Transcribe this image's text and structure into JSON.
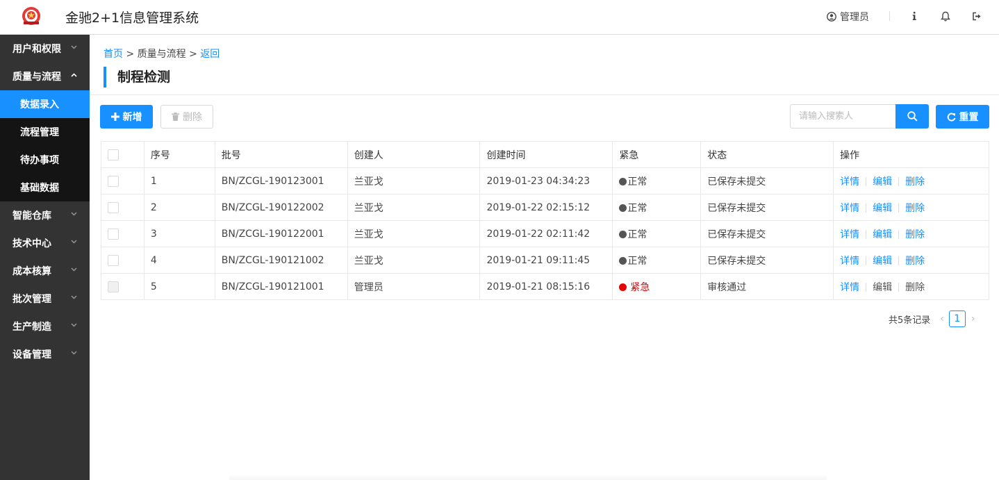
{
  "app": {
    "title": "金驰2+1信息管理系统",
    "user_name": "管理员",
    "logo_icon": "seal-logo",
    "colors": {
      "primary": "#1890ff",
      "sidebar": "#333333",
      "submenu": "#141414",
      "urgent": "#e60000"
    }
  },
  "sidebar": {
    "groups": [
      {
        "label": "用户和权限",
        "expanded": false
      },
      {
        "label": "质量与流程",
        "expanded": true,
        "items": [
          {
            "label": "数据录入",
            "active": true
          },
          {
            "label": "流程管理",
            "active": false
          },
          {
            "label": "待办事项",
            "active": false
          },
          {
            "label": "基础数据",
            "active": false
          }
        ]
      },
      {
        "label": "智能仓库",
        "expanded": false
      },
      {
        "label": "技术中心",
        "expanded": false
      },
      {
        "label": "成本核算",
        "expanded": false
      },
      {
        "label": "批次管理",
        "expanded": false
      },
      {
        "label": "生产制造",
        "expanded": false
      },
      {
        "label": "设备管理",
        "expanded": false
      }
    ]
  },
  "breadcrumb": {
    "home": "首页",
    "sep": ">",
    "current": "质量与流程",
    "back": "返回"
  },
  "page_title": "制程检测",
  "toolbar": {
    "add_label": "新增",
    "delete_label": "删除",
    "search_placeholder": "请输入搜索人",
    "reset_label": "重置"
  },
  "table": {
    "headers": [
      "序号",
      "批号",
      "创建人",
      "创建时间",
      "紧急",
      "状态",
      "操作"
    ],
    "rows": [
      {
        "no": "1",
        "batch": "BN/ZCGL-190123001",
        "creator": "兰亚戈",
        "time": "2019-01-23 04:34:23",
        "urgency": "正常",
        "urgent": false,
        "status": "已保存未提交",
        "editable": true
      },
      {
        "no": "2",
        "batch": "BN/ZCGL-190122002",
        "creator": "兰亚戈",
        "time": "2019-01-22 02:15:12",
        "urgency": "正常",
        "urgent": false,
        "status": "已保存未提交",
        "editable": true
      },
      {
        "no": "3",
        "batch": "BN/ZCGL-190122001",
        "creator": "兰亚戈",
        "time": "2019-01-22 02:11:42",
        "urgency": "正常",
        "urgent": false,
        "status": "已保存未提交",
        "editable": true
      },
      {
        "no": "4",
        "batch": "BN/ZCGL-190121002",
        "creator": "兰亚戈",
        "time": "2019-01-21 09:11:45",
        "urgency": "正常",
        "urgent": false,
        "status": "已保存未提交",
        "editable": true
      },
      {
        "no": "5",
        "batch": "BN/ZCGL-190121001",
        "creator": "管理员",
        "time": "2019-01-21 08:15:16",
        "urgency": "紧急",
        "urgent": true,
        "status": "审核通过",
        "editable": false
      }
    ],
    "actions": {
      "detail": "详情",
      "edit": "编辑",
      "delete": "删除"
    }
  },
  "pagination": {
    "total_text": "共5条记录",
    "current_page": "1"
  }
}
